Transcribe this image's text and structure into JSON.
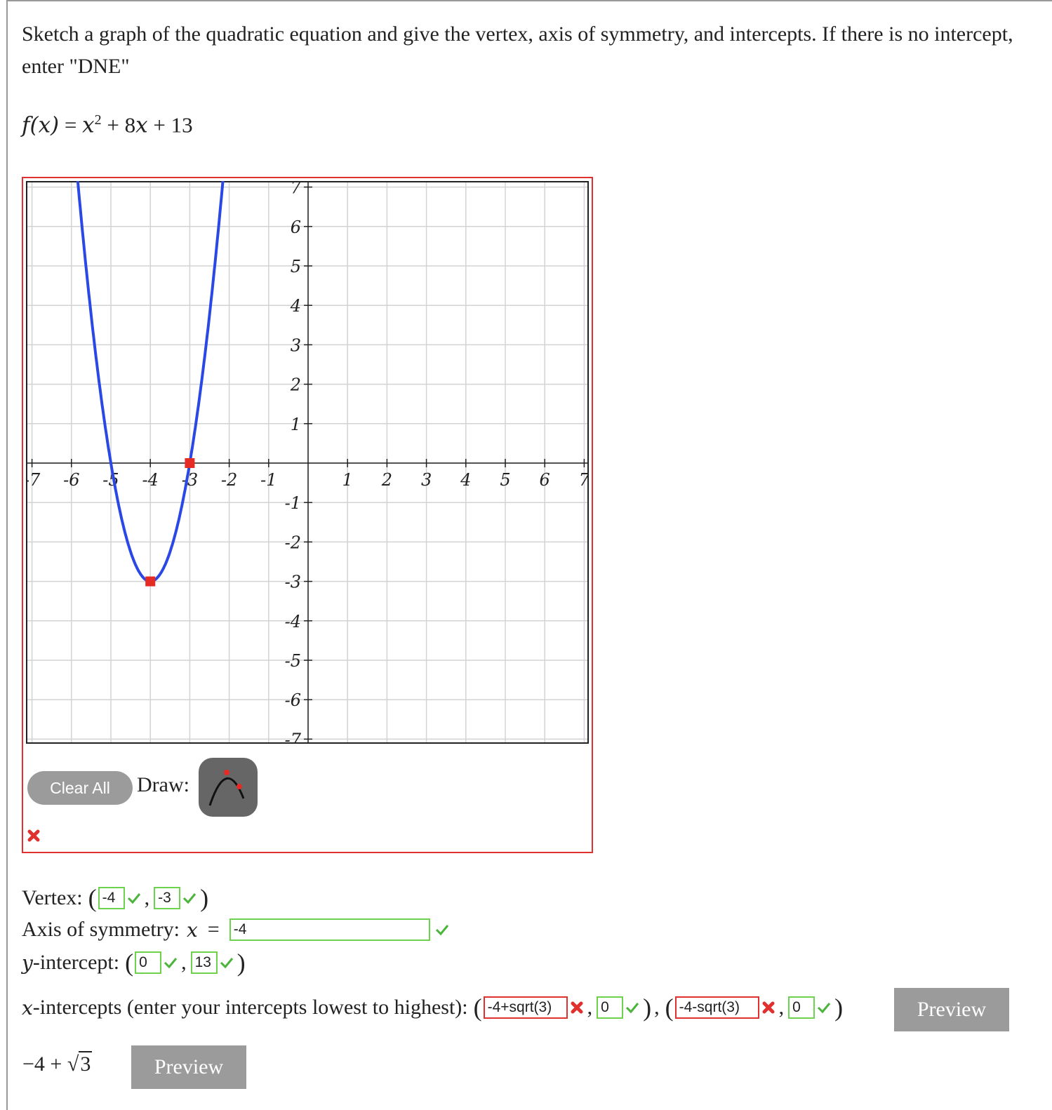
{
  "question": {
    "text": "Sketch a graph of the quadratic equation and give the vertex, axis of symmetry, and intercepts. If there is no intercept, enter \"DNE\"",
    "function_lhs": "f(x)",
    "function_rhs_parts": [
      "x",
      "2",
      " + 8",
      "x",
      " + 13"
    ]
  },
  "graph": {
    "x_ticks": [
      "-7",
      "-6",
      "-5",
      "-4",
      "-3",
      "-2",
      "-1",
      "1",
      "2",
      "3",
      "4",
      "5",
      "6",
      "7"
    ],
    "y_ticks": [
      "7",
      "6",
      "5",
      "4",
      "3",
      "2",
      "1",
      "-1",
      "-2",
      "-3",
      "-4",
      "-5",
      "-6",
      "-7"
    ],
    "curve_color": "#2a48e6",
    "point_color": "#e52b24",
    "points": [
      {
        "x": -4,
        "y": -3
      },
      {
        "x": -3,
        "y": 0
      }
    ],
    "clear_label": "Clear All",
    "draw_label": "Draw:",
    "tool_icon": "parabola-tool-icon",
    "status": "incorrect"
  },
  "answers": {
    "vertex_label": "Vertex:",
    "vertex_x": "-4",
    "vertex_y": "-3",
    "axis_label": "Axis of symmetry:",
    "axis_var": "x",
    "axis_eq": "=",
    "axis_value": "-4",
    "yint_var": "y",
    "yint_label": "-intercept:",
    "yint_x": "0",
    "yint_y": "13",
    "xint_var": "x",
    "xint_label": "-intercepts (enter your intercepts lowest to highest):",
    "xint1_x": "-4+sqrt(3)",
    "xint1_y": "0",
    "xint2_x": "-4-sqrt(3)",
    "xint2_y": "0",
    "preview_label": "Preview",
    "preview_math_prefix": "−4 + ",
    "preview_math_radicand": "3",
    "preview2_label": "Preview"
  },
  "colors": {
    "correct": "#6dd34f",
    "incorrect": "#e0312e",
    "button_gray": "#9b9b9b"
  }
}
